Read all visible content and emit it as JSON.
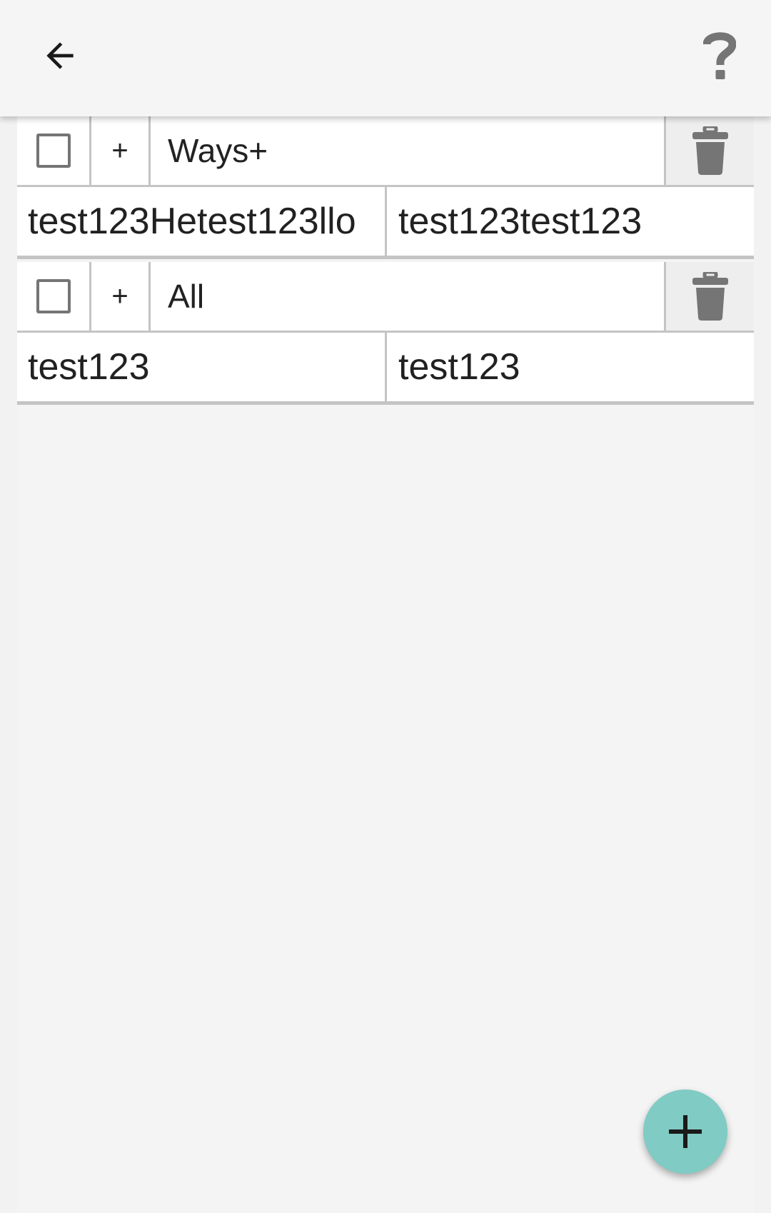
{
  "appbar": {
    "back_icon": "arrow-back-icon",
    "help_icon": "help-question-icon",
    "help_label": "?"
  },
  "groups": [
    {
      "checked": false,
      "plus_label": "+",
      "name": "Ways+",
      "key": "test123Hetest123llo",
      "value": "test123test123",
      "delete_icon": "trash-icon"
    },
    {
      "checked": false,
      "plus_label": "+",
      "name": "All",
      "key": "test123",
      "value": "test123",
      "delete_icon": "trash-icon"
    }
  ],
  "fab": {
    "icon": "add-icon"
  },
  "colors": {
    "fab": "#80cbc4",
    "appbar": "#f5f5f5",
    "background": "#f4f4f4",
    "divider": "#c4c4c4"
  }
}
